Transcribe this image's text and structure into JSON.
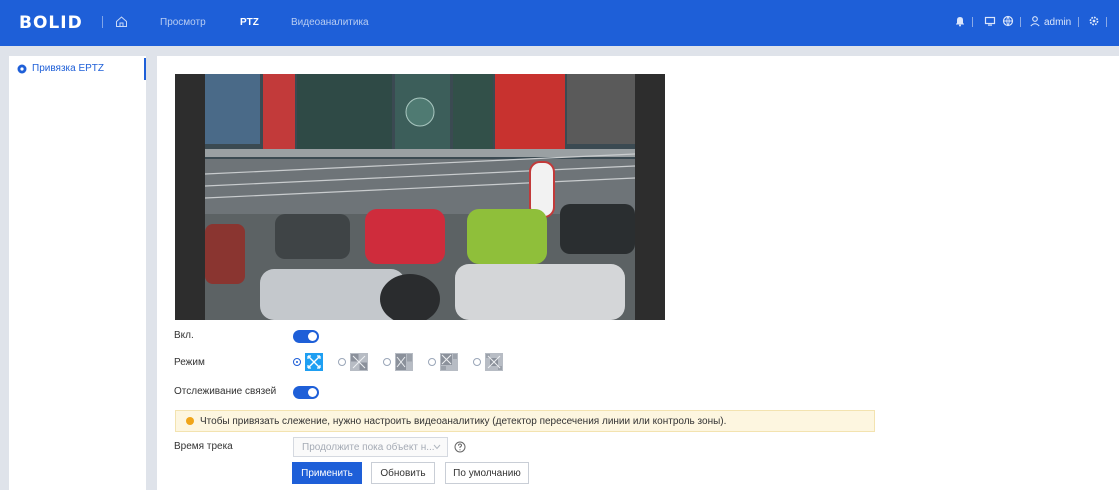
{
  "header": {
    "logo": "BOLID",
    "nav": [
      {
        "label": "Просмотр",
        "active": false
      },
      {
        "label": "PTZ",
        "active": true
      },
      {
        "label": "Видеоаналитика",
        "active": false
      }
    ],
    "user": "admin",
    "accent_color": "#1e5fd8"
  },
  "sidebar": {
    "items": [
      {
        "label": "Привязка EPTZ",
        "icon": "gear-icon",
        "active": true
      }
    ]
  },
  "form": {
    "enable_label": "Вкл.",
    "enable_on": true,
    "mode_label": "Режим",
    "modes": [
      {
        "icon": "mode-full-icon",
        "selected": true
      },
      {
        "icon": "mode-grid-2x2-icon",
        "selected": false
      },
      {
        "icon": "mode-grid-3-icon",
        "selected": false
      },
      {
        "icon": "mode-grid-4-icon",
        "selected": false
      },
      {
        "icon": "mode-grid-5-icon",
        "selected": false
      }
    ],
    "tracking_label": "Отслеживание связей",
    "tracking_on": true,
    "notice": "Чтобы привязать слежение, нужно настроить видеоаналитику (детектор пересечения линии или контроль зоны).",
    "track_time_label": "Время трека",
    "track_time_value": "Продолжите пока объект н...",
    "buttons": {
      "apply": "Применить",
      "refresh": "Обновить",
      "default": "По умолчанию"
    }
  }
}
